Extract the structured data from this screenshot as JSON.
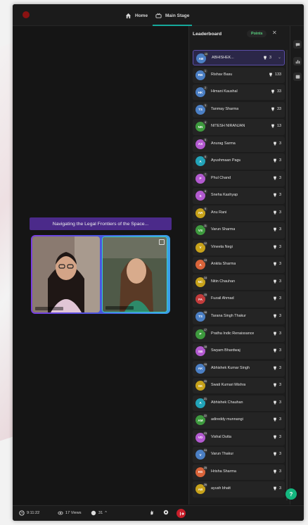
{
  "nav": {
    "home_label": "Home",
    "main_stage_label": "Main Stage",
    "accent": "#15a89a"
  },
  "stage": {
    "session_title": "Navigating the Legal Frontiers of the Space..."
  },
  "leaderboard": {
    "title": "Leaderboard",
    "points_label": "Points",
    "close_icon": "close-icon",
    "rows": [
      {
        "rank": "10",
        "initials": "AB",
        "name": "ABHISHEK...",
        "points": "3",
        "color": "#4b7fc4",
        "me": true
      },
      {
        "rank": "1",
        "initials": "RB",
        "name": "Rishav Basu",
        "points": "133",
        "color": "#4b7fc4"
      },
      {
        "rank": "2",
        "initials": "HK",
        "name": "Himani Kaushal",
        "points": "33",
        "color": "#4b7fc4"
      },
      {
        "rank": "3",
        "initials": "TS",
        "name": "Tanmay Sharma",
        "points": "33",
        "color": "#4b7fc4"
      },
      {
        "rank": "4",
        "initials": "NN",
        "name": "NITESH NIRANJAN",
        "points": "13",
        "color": "#3e9a3e"
      },
      {
        "rank": "5",
        "initials": "AS",
        "name": "Anurag Sarma",
        "points": "3",
        "color": "#b35ad0"
      },
      {
        "rank": "6",
        "initials": "A",
        "name": "Ayushmaan Pagu",
        "points": "3",
        "color": "#22a3b8"
      },
      {
        "rank": "7",
        "initials": "P",
        "name": "Phul Chand",
        "points": "3",
        "color": "#b35ad0"
      },
      {
        "rank": "8",
        "initials": "S",
        "name": "Sneha Kashyap",
        "points": "3",
        "color": "#b35ad0"
      },
      {
        "rank": "9",
        "initials": "AR",
        "name": "Anu Rani",
        "points": "3",
        "color": "#c7a21a"
      },
      {
        "rank": "11",
        "initials": "VS",
        "name": "Varun Sharma",
        "points": "3",
        "color": "#3e9a3e"
      },
      {
        "rank": "12",
        "initials": "V",
        "name": "Vineeta Negi",
        "points": "3",
        "color": "#c7a21a"
      },
      {
        "rank": "13",
        "initials": "A",
        "name": "Ankita Sharma",
        "points": "3",
        "color": "#d9643a"
      },
      {
        "rank": "14",
        "initials": "NC",
        "name": "Nitin Chauhan",
        "points": "3",
        "color": "#c7a21a"
      },
      {
        "rank": "15",
        "initials": "FA",
        "name": "Fuzail Ahmad",
        "points": "3",
        "color": "#c23b3b"
      },
      {
        "rank": "16",
        "initials": "TS",
        "name": "Tarana Singh Thakur",
        "points": "3",
        "color": "#4b7fc4"
      },
      {
        "rank": "17",
        "initials": "P",
        "name": "Pratha Indic Renaissance",
        "points": "3",
        "color": "#3e9a3e"
      },
      {
        "rank": "18",
        "initials": "SB",
        "name": "Swyam Bhardwaj",
        "points": "3",
        "color": "#b35ad0"
      },
      {
        "rank": "19",
        "initials": "AK",
        "name": "Abhishek Kumar Singh",
        "points": "3",
        "color": "#4b7fc4"
      },
      {
        "rank": "20",
        "initials": "SK",
        "name": "Swati Kumari Mishra",
        "points": "3",
        "color": "#c7a21a"
      },
      {
        "rank": "21",
        "initials": "A",
        "name": "Abhishek Chauhan",
        "points": "3",
        "color": "#22a3b8"
      },
      {
        "rank": "22",
        "initials": "AM",
        "name": "adireddy munnangi",
        "points": "3",
        "color": "#3e9a3e"
      },
      {
        "rank": "23",
        "initials": "VD",
        "name": "Vishal Dutta",
        "points": "3",
        "color": "#b35ad0"
      },
      {
        "rank": "24",
        "initials": "V",
        "name": "Varun Thakur",
        "points": "3",
        "color": "#4b7fc4"
      },
      {
        "rank": "25",
        "initials": "HS",
        "name": "Hrisha Sharma",
        "points": "3",
        "color": "#d9643a"
      },
      {
        "rank": "26",
        "initials": "AB",
        "name": "ayush bhatt",
        "points": "3",
        "color": "#c7a21a"
      }
    ]
  },
  "bottombar": {
    "timer": "9:11:22",
    "views": "17 Views",
    "reactions": "31"
  },
  "rail": {
    "icons": [
      "chat-icon",
      "poll-icon",
      "qna-icon"
    ]
  },
  "help_label": "?"
}
